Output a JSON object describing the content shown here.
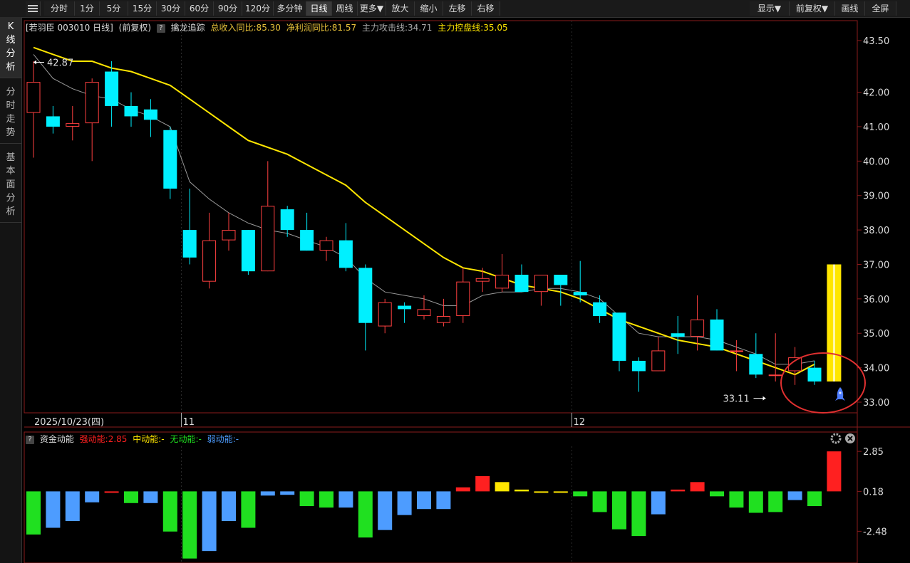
{
  "toolbar": {
    "period_buttons": [
      "分时",
      "1分",
      "5分",
      "15分",
      "30分",
      "60分",
      "90分",
      "120分",
      "多分钟",
      "日线",
      "周线",
      "更多▼",
      "放大",
      "缩小",
      "左移",
      "右移"
    ],
    "right_buttons": [
      "显示▼",
      "前复权▼",
      "画线",
      "全屏"
    ],
    "active": "日线"
  },
  "sidetabs": [
    {
      "label": "K线分析",
      "active": true
    },
    {
      "label": "分时走势",
      "active": false
    },
    {
      "label": "基本面分析",
      "active": false
    }
  ],
  "info": {
    "stock": "[若羽臣 003010 日线]",
    "adjust": "(前复权)",
    "indicator": "擒龙追踪",
    "income_yoy": "总收入同比:85.30",
    "profit_yoy": "净利润同比:81.57",
    "attack_line": "主力攻击线:34.71",
    "control_line": "主力控盘线:35.05",
    "colors": {
      "white": "#dddddd",
      "gold": "#e8c23a",
      "gray": "#aaaaaa",
      "yellow": "#ffe600"
    }
  },
  "sub_info": {
    "name": "资金动能",
    "strong": "强动能:2.85",
    "mid": "中动能:-",
    "none": "无动能:-",
    "weak": "弱动能:-",
    "colors": {
      "strong": "#ff2020",
      "mid": "#ffe600",
      "none": "#20e020",
      "weak": "#4d9cff"
    }
  },
  "chart_data": [
    {
      "type": "candlestick",
      "title": "若羽臣 003010 日线",
      "ylim": [
        33.0,
        43.5
      ],
      "y_ticks": [
        "43.50",
        "42.00",
        "41.00",
        "40.00",
        "39.00",
        "38.00",
        "37.00",
        "36.00",
        "35.00",
        "34.00",
        "33.00"
      ],
      "x_labels": [
        "2025/10/23(四)",
        "11",
        "12"
      ],
      "x_label_index": [
        0,
        8,
        28
      ],
      "colors": {
        "up": "#ff4040",
        "down": "#00f0ff",
        "ma_fast": "#999999",
        "ma_slow": "#ffe600",
        "highlight": "#ffe600"
      },
      "candles": [
        {
          "o": 41.4,
          "h": 42.9,
          "l": 40.1,
          "c": 42.3
        },
        {
          "o": 41.3,
          "h": 41.6,
          "l": 40.8,
          "c": 41.0
        },
        {
          "o": 41.0,
          "h": 41.6,
          "l": 40.6,
          "c": 41.1
        },
        {
          "o": 41.1,
          "h": 42.4,
          "l": 40.0,
          "c": 42.3
        },
        {
          "o": 42.6,
          "h": 42.9,
          "l": 41.0,
          "c": 41.6
        },
        {
          "o": 41.6,
          "h": 42.0,
          "l": 41.0,
          "c": 41.3
        },
        {
          "o": 41.5,
          "h": 41.8,
          "l": 40.7,
          "c": 41.2
        },
        {
          "o": 40.9,
          "h": 41.0,
          "l": 38.9,
          "c": 39.2
        },
        {
          "o": 38.0,
          "h": 39.2,
          "l": 37.0,
          "c": 37.2
        },
        {
          "o": 36.5,
          "h": 38.5,
          "l": 36.3,
          "c": 37.7
        },
        {
          "o": 37.7,
          "h": 38.5,
          "l": 37.4,
          "c": 38.0
        },
        {
          "o": 38.0,
          "h": 38.0,
          "l": 36.7,
          "c": 36.8
        },
        {
          "o": 36.8,
          "h": 40.0,
          "l": 36.8,
          "c": 38.7
        },
        {
          "o": 38.6,
          "h": 38.7,
          "l": 37.8,
          "c": 38.0
        },
        {
          "o": 38.0,
          "h": 38.5,
          "l": 37.4,
          "c": 37.4
        },
        {
          "o": 37.4,
          "h": 37.8,
          "l": 37.1,
          "c": 37.7
        },
        {
          "o": 37.7,
          "h": 38.2,
          "l": 36.8,
          "c": 36.9
        },
        {
          "o": 36.9,
          "h": 37.0,
          "l": 34.5,
          "c": 35.3
        },
        {
          "o": 35.2,
          "h": 36.0,
          "l": 35.0,
          "c": 35.9
        },
        {
          "o": 35.8,
          "h": 35.9,
          "l": 35.3,
          "c": 35.7
        },
        {
          "o": 35.5,
          "h": 36.1,
          "l": 35.4,
          "c": 35.7
        },
        {
          "o": 35.3,
          "h": 36.0,
          "l": 35.2,
          "c": 35.5
        },
        {
          "o": 35.5,
          "h": 36.9,
          "l": 35.3,
          "c": 36.5
        },
        {
          "o": 36.5,
          "h": 36.9,
          "l": 36.2,
          "c": 36.6
        },
        {
          "o": 36.3,
          "h": 37.3,
          "l": 36.2,
          "c": 36.7
        },
        {
          "o": 36.7,
          "h": 37.0,
          "l": 36.2,
          "c": 36.2
        },
        {
          "o": 36.2,
          "h": 36.7,
          "l": 35.8,
          "c": 36.7
        },
        {
          "o": 36.7,
          "h": 36.7,
          "l": 35.8,
          "c": 36.4
        },
        {
          "o": 36.2,
          "h": 37.1,
          "l": 35.9,
          "c": 36.1
        },
        {
          "o": 35.9,
          "h": 36.1,
          "l": 35.3,
          "c": 35.5
        },
        {
          "o": 35.6,
          "h": 35.6,
          "l": 33.9,
          "c": 34.2
        },
        {
          "o": 34.2,
          "h": 34.3,
          "l": 33.3,
          "c": 33.9
        },
        {
          "o": 33.9,
          "h": 34.9,
          "l": 33.9,
          "c": 34.5
        },
        {
          "o": 35.0,
          "h": 35.5,
          "l": 34.4,
          "c": 34.9
        },
        {
          "o": 34.9,
          "h": 36.1,
          "l": 34.5,
          "c": 35.4
        },
        {
          "o": 35.4,
          "h": 35.7,
          "l": 34.5,
          "c": 34.5
        },
        {
          "o": 34.5,
          "h": 34.8,
          "l": 33.9,
          "c": 34.5
        },
        {
          "o": 34.4,
          "h": 35.0,
          "l": 33.7,
          "c": 33.8
        },
        {
          "o": 33.8,
          "h": 35.0,
          "l": 33.6,
          "c": 33.8
        },
        {
          "o": 33.9,
          "h": 34.6,
          "l": 33.5,
          "c": 34.3
        },
        {
          "o": 34.0,
          "h": 34.2,
          "l": 33.5,
          "c": 33.6
        }
      ],
      "ma_fast": [
        43.1,
        42.4,
        42.1,
        41.9,
        41.8,
        41.5,
        41.3,
        41.0,
        39.4,
        38.9,
        38.5,
        38.2,
        38.0,
        37.9,
        37.7,
        37.5,
        37.2,
        36.6,
        36.2,
        36.1,
        36.0,
        35.8,
        35.8,
        36.1,
        36.2,
        36.2,
        36.3,
        36.3,
        36.2,
        36.0,
        35.5,
        35.0,
        34.9,
        34.9,
        34.9,
        34.8,
        34.6,
        34.4,
        34.1,
        34.1,
        34.2
      ],
      "ma_slow": [
        43.3,
        43.1,
        42.9,
        42.9,
        42.7,
        42.6,
        42.4,
        42.2,
        41.8,
        41.4,
        41.0,
        40.6,
        40.4,
        40.2,
        39.9,
        39.6,
        39.3,
        38.8,
        38.4,
        38.0,
        37.6,
        37.2,
        36.9,
        36.8,
        36.6,
        36.4,
        36.3,
        36.2,
        36.0,
        35.7,
        35.4,
        35.2,
        35.0,
        34.8,
        34.7,
        34.6,
        34.4,
        34.2,
        34.0,
        33.8,
        34.1
      ],
      "highlight_bar": {
        "low": 33.6,
        "high": 37.0
      },
      "annotations": {
        "high_label": "42.87",
        "high_value": 42.87,
        "high_index": 0,
        "low_label": "33.11",
        "low_value": 33.11,
        "low_index": 38
      }
    },
    {
      "type": "bar",
      "title": "资金动能",
      "ylim": [
        -4.6,
        3.0
      ],
      "y_ticks": [
        "2.85",
        "0.18",
        "-2.48"
      ],
      "values": [
        -2.7,
        -2.25,
        -1.8,
        -0.55,
        0.12,
        -0.6,
        -0.6,
        -2.5,
        -4.3,
        -3.8,
        -1.8,
        -2.25,
        -0.1,
        -0.05,
        -0.8,
        -0.9,
        -0.9,
        -2.9,
        -2.4,
        -1.4,
        -1.0,
        -1.0,
        0.45,
        1.2,
        0.8,
        0.3,
        0.15,
        0.1,
        -0.15,
        -1.2,
        -2.35,
        -2.8,
        -1.35,
        0.3,
        0.8,
        -0.15,
        -0.9,
        -1.25,
        -1.2,
        -0.4,
        -0.8,
        2.85
      ],
      "bar_colors": [
        "#20e020",
        "#4d9cff",
        "#4d9cff",
        "#4d9cff",
        "#ff2020",
        "#20e020",
        "#4d9cff",
        "#20e020",
        "#20e020",
        "#4d9cff",
        "#4d9cff",
        "#20e020",
        "#4d9cff",
        "#4d9cff",
        "#20e020",
        "#20e020",
        "#4d9cff",
        "#20e020",
        "#4d9cff",
        "#4d9cff",
        "#4d9cff",
        "#4d9cff",
        "#ff2020",
        "#ff2020",
        "#ffe600",
        "#ffe600",
        "#ffe600",
        "#ffe600",
        "#20e020",
        "#20e020",
        "#20e020",
        "#20e020",
        "#4d9cff",
        "#ff2020",
        "#ff2020",
        "#20e020",
        "#20e020",
        "#20e020",
        "#20e020",
        "#4d9cff",
        "#20e020",
        "#ff2020"
      ]
    }
  ]
}
